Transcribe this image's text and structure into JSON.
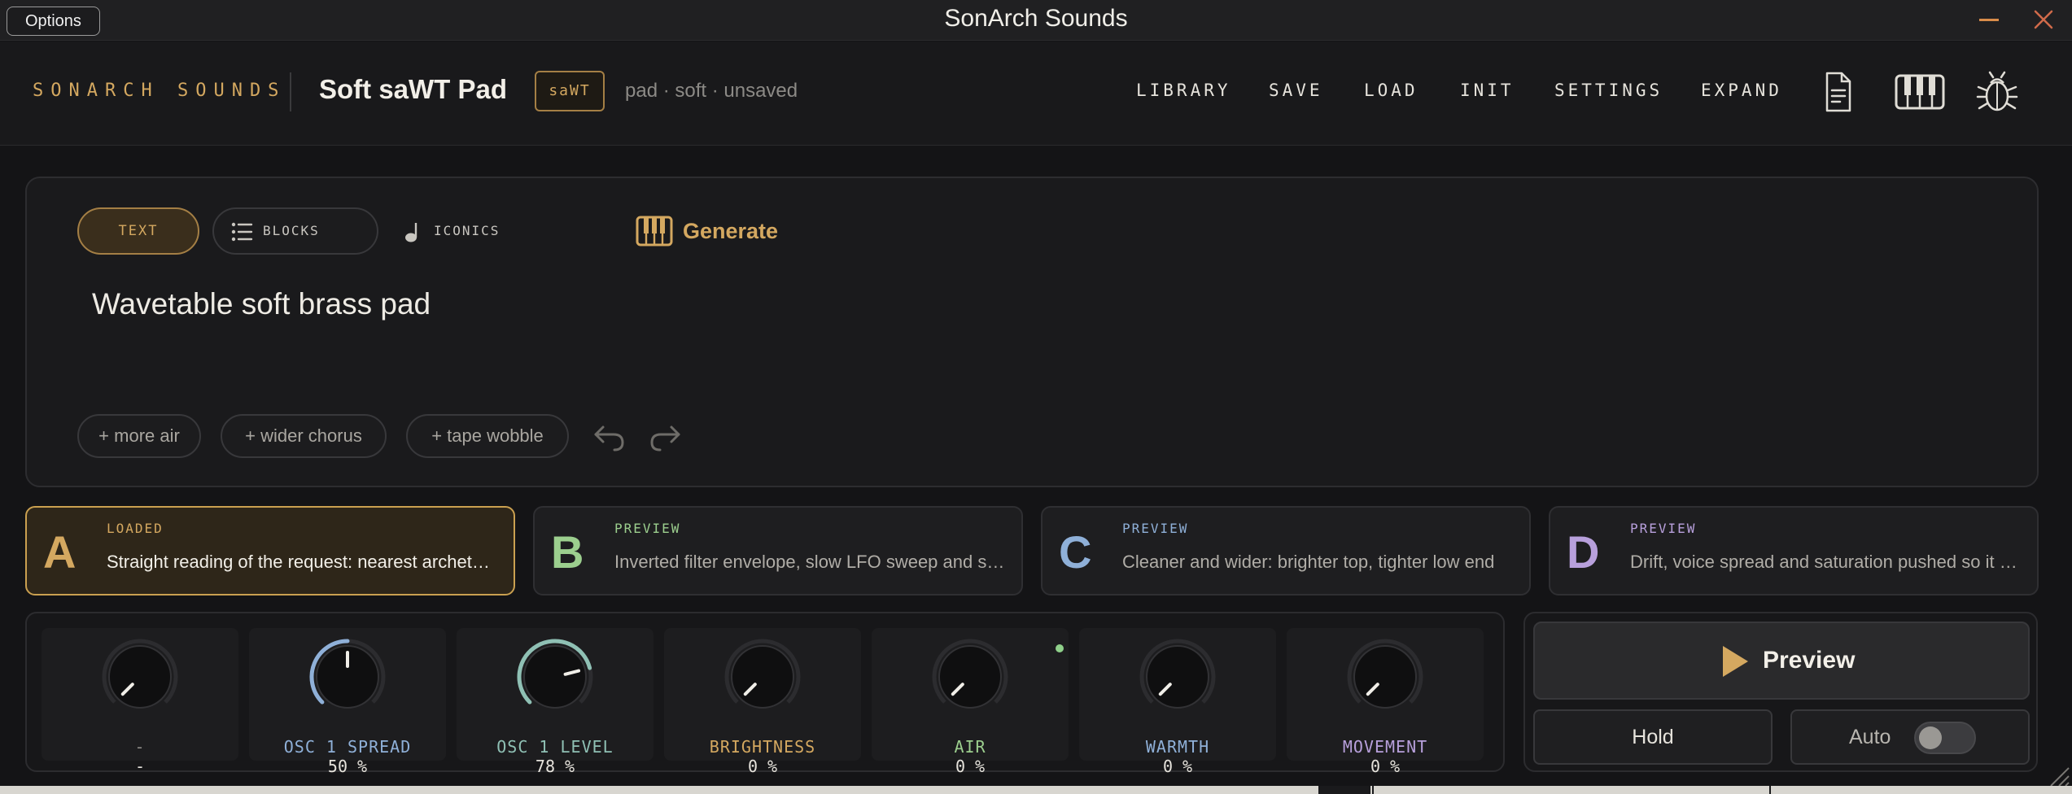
{
  "titlebar": {
    "options_label": "Options",
    "title": "SonArch Sounds",
    "minimize_icon": "minimize-icon",
    "close_icon": "close-icon"
  },
  "header": {
    "brand": "SONARCH SOUNDS",
    "preset_name": "Soft saWT Pad",
    "preset_tag": "saWT",
    "preset_meta": "pad · soft · unsaved",
    "nav": [
      "LIBRARY",
      "SAVE",
      "LOAD",
      "INIT",
      "SETTINGS",
      "EXPAND"
    ],
    "icons": [
      "document-icon",
      "piano-keys-icon",
      "bug-icon"
    ]
  },
  "prompt": {
    "modes": [
      "TEXT",
      "BLOCKS",
      "ICONICS"
    ],
    "active_mode": "TEXT",
    "generate_label": "Generate",
    "text": "Wavetable soft brass pad",
    "chips": [
      "+ more air",
      "+ wider chorus",
      "+ tape wobble"
    ]
  },
  "variants": [
    {
      "letter": "A",
      "status": "LOADED",
      "desc": "Straight reading of the request: nearest archetype with gentle shaping",
      "color": "#d4a860"
    },
    {
      "letter": "B",
      "status": "PREVIEW",
      "desc": "Inverted filter envelope, slow LFO sweep and softer attack",
      "color": "#9ccf8e"
    },
    {
      "letter": "C",
      "status": "PREVIEW",
      "desc": "Cleaner and wider: brighter top, tighter low end",
      "color": "#8fb0d8"
    },
    {
      "letter": "D",
      "status": "PREVIEW",
      "desc": "Drift, voice spread and saturation pushed so it feels alive",
      "color": "#b8a0dc"
    }
  ],
  "knobs": [
    {
      "label": "-",
      "value": "-",
      "color": "#8c8a86",
      "level": 0
    },
    {
      "label": "OSC 1 SPREAD",
      "value": "50 %",
      "color": "#8fb0d8",
      "level": 0.5
    },
    {
      "label": "OSC 1 LEVEL",
      "value": "78 %",
      "color": "#8fc0b4",
      "level": 0.78
    },
    {
      "label": "BRIGHTNESS",
      "value": "0 %",
      "color": "#d4a860",
      "level": 0
    },
    {
      "label": "AIR",
      "value": "0 %",
      "color": "#9ccf8e",
      "level": 0
    },
    {
      "label": "WARMTH",
      "value": "0 %",
      "color": "#8fb0d8",
      "level": 0
    },
    {
      "label": "MOVEMENT",
      "value": "0 %",
      "color": "#b8a0dc",
      "level": 0
    }
  ],
  "play": {
    "preview_label": "Preview",
    "hold_label": "Hold",
    "auto_label": "Auto",
    "auto_on": false
  },
  "colors": {
    "accent": "#d4a860",
    "background": "#141416"
  }
}
